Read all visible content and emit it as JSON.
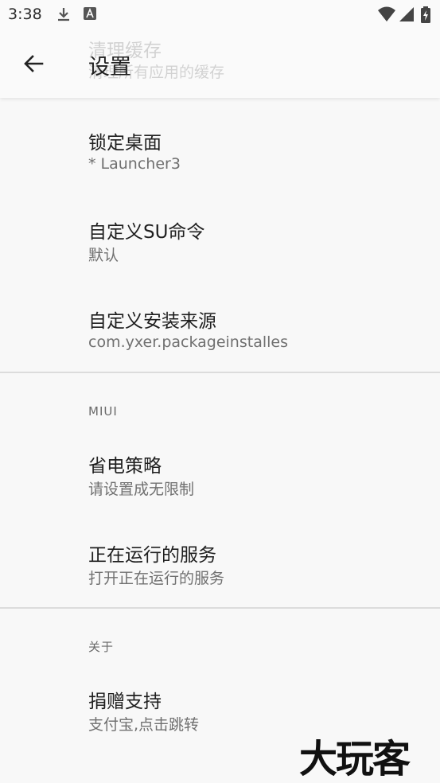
{
  "status_bar": {
    "time": "3:38",
    "icons": [
      "download-icon",
      "text-notification-icon",
      "wifi-icon",
      "cellular-signal-icon",
      "battery-charging-icon"
    ]
  },
  "app_bar": {
    "title": "设置",
    "back_icon": "arrow-left-icon"
  },
  "ghost_item": {
    "title": "清理缓存",
    "summary": "清理所有应用的缓存"
  },
  "general": {
    "items": [
      {
        "title": "锁定桌面",
        "summary": "* Launcher3"
      },
      {
        "title": "自定义SU命令",
        "summary": "默认"
      },
      {
        "title": "自定义安装来源",
        "summary": "com.yxer.packageinstalles"
      }
    ]
  },
  "miui": {
    "header": "MIUI",
    "items": [
      {
        "title": "省电策略",
        "summary": "请设置成无限制"
      },
      {
        "title": "正在运行的服务",
        "summary": "打开正在运行的服务"
      }
    ]
  },
  "about": {
    "header": "关于",
    "items": [
      {
        "title": "捐赠支持",
        "summary": "支付宝,点击跳转"
      }
    ]
  },
  "watermark": "大玩客"
}
